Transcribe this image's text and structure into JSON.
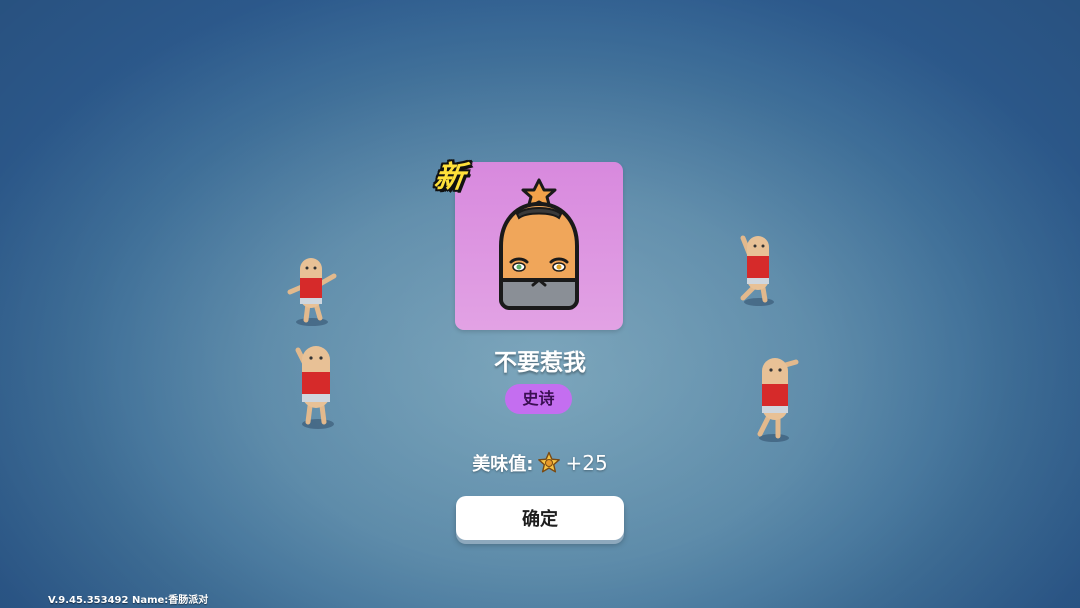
{
  "reward": {
    "new_badge": "新",
    "item_name": "不要惹我",
    "rarity": "史诗",
    "score_label": "美味值:",
    "score_value": "+25",
    "confirm_label": "确定",
    "card_color": "#d889de",
    "rarity_color": "#c46ef0"
  },
  "footer": {
    "version": "V.9.45.353492 Name:香肠派对"
  },
  "icons": {
    "item": "sausage-head-costume-icon",
    "score": "star-coin-icon"
  }
}
